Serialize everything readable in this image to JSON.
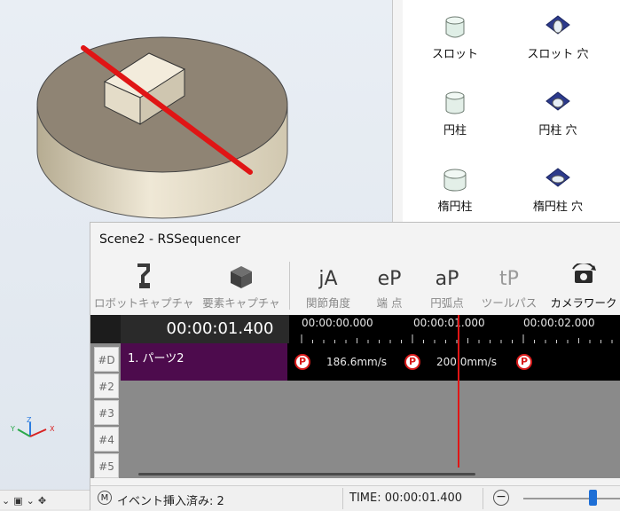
{
  "window": {
    "title": "Scene2 - RSSequencer"
  },
  "palette": {
    "items": [
      {
        "label": "スロット",
        "icon": "slot-shape-icon"
      },
      {
        "label": "スロット 穴",
        "icon": "slot-hole-icon"
      },
      {
        "label": "円柱",
        "icon": "cylinder-icon"
      },
      {
        "label": "円柱 穴",
        "icon": "cylinder-hole-icon"
      },
      {
        "label": "楕円柱",
        "icon": "elliptic-cylinder-icon"
      },
      {
        "label": "楕円柱 穴",
        "icon": "elliptic-cylinder-hole-icon"
      }
    ]
  },
  "ribbon": {
    "buttons": [
      {
        "label": "ロボットキャプチャ",
        "icon": "robot-capture-icon",
        "enabled": false
      },
      {
        "label": "要素キャプチャ",
        "icon": "element-capture-icon",
        "enabled": false
      },
      {
        "label": "関節角度",
        "icon_text": "jA",
        "enabled": false
      },
      {
        "label": "端 点",
        "icon_text": "eP",
        "enabled": false
      },
      {
        "label": "円弧点",
        "icon_text": "aP",
        "enabled": false
      },
      {
        "label": "ツールパス",
        "icon_text": "tP",
        "enabled": false
      },
      {
        "label": "カメラワーク",
        "icon": "camera-work-icon",
        "enabled": true
      }
    ]
  },
  "timeline": {
    "current_time": "00:00:01.400",
    "ruler_labels": [
      "00:00:00.000",
      "00:00:01.000",
      "00:00:02.000"
    ],
    "rows": [
      "#D",
      "#2",
      "#3",
      "#4",
      "#5"
    ],
    "track": {
      "part_label": "1. パーツ2",
      "point_label": "P",
      "speeds": [
        "186.6mm/s",
        "200.0mm/s"
      ]
    }
  },
  "status": {
    "mode": "M",
    "event_text": "イベント挿入済み: 2",
    "time_text": "TIME: 00:00:01.400",
    "zoom_out": "−"
  },
  "colors": {
    "accent_red": "#e01515",
    "track_purple": "#4d0b4d",
    "slider_blue": "#1e6fd6"
  }
}
